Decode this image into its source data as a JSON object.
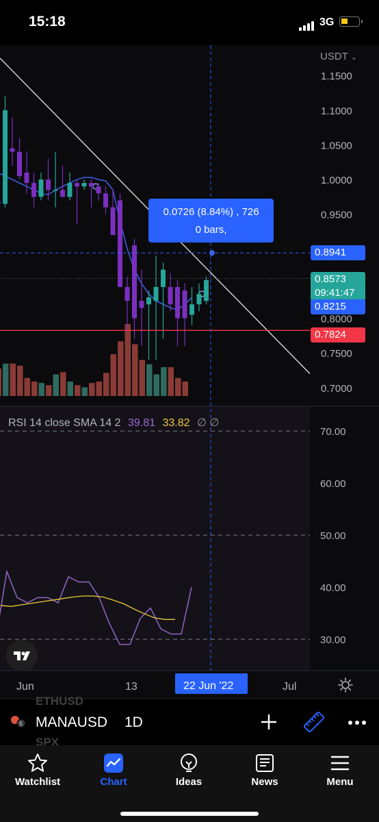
{
  "status_bar": {
    "time": "15:18",
    "network": "3G"
  },
  "chart": {
    "currency": "USDT",
    "price_axis": [
      "1.1500",
      "1.1000",
      "1.0500",
      "1.0000",
      "0.9500",
      "0.8000",
      "0.7500",
      "0.7000"
    ],
    "rsi_axis": [
      "70.00",
      "60.00",
      "50.00",
      "40.00",
      "30.00"
    ],
    "time_axis": {
      "jun": "Jun",
      "d13": "13",
      "crosshair": "22 Jun '22",
      "jul": "Jul"
    },
    "tooltip": {
      "line1": "0.0726 (8.84%) , 726",
      "line2": "0 bars,"
    },
    "price_tags": {
      "crosshair": "0.8941",
      "last": "0.8573",
      "countdown": "09:41:47",
      "sma": "0.8215",
      "horizontal": "0.7824"
    },
    "rsi_legend": {
      "name": "RSI",
      "params": "14 close SMA 14 2",
      "rsi_value": "39.81",
      "sma_value": "33.82",
      "symbols": "∅ ∅"
    },
    "colors": {
      "up": "#26a69a",
      "down": "#7b2fbf",
      "ma": "#3d62e8",
      "rsi": "#9c6ad6",
      "rsi_ma": "#f0c83c",
      "hline": "#f23645",
      "accent": "#2962ff"
    }
  },
  "chart_data": {
    "type": "candlestick",
    "symbol": "MANAUSD",
    "interval": "1D",
    "y_range": [
      0.68,
      1.17
    ],
    "candles": [
      {
        "o": 0.97,
        "h": 1.07,
        "l": 0.955,
        "c": 0.965
      },
      {
        "o": 0.965,
        "h": 1.12,
        "l": 0.96,
        "c": 1.1
      },
      {
        "o": 1.045,
        "h": 1.09,
        "l": 1.02,
        "c": 1.04
      },
      {
        "o": 1.04,
        "h": 1.06,
        "l": 1.0,
        "c": 1.005
      },
      {
        "o": 1.01,
        "h": 1.04,
        "l": 0.98,
        "c": 0.995
      },
      {
        "o": 0.995,
        "h": 1.01,
        "l": 0.96,
        "c": 0.975
      },
      {
        "o": 0.975,
        "h": 1.01,
        "l": 0.97,
        "c": 1.0
      },
      {
        "o": 1.0,
        "h": 1.03,
        "l": 0.97,
        "c": 0.985
      },
      {
        "o": 0.985,
        "h": 1.04,
        "l": 0.96,
        "c": 0.985
      },
      {
        "o": 0.985,
        "h": 1.02,
        "l": 0.975,
        "c": 0.975
      },
      {
        "o": 0.975,
        "h": 1.01,
        "l": 0.97,
        "c": 0.995
      },
      {
        "o": 0.995,
        "h": 1.0,
        "l": 0.935,
        "c": 0.99
      },
      {
        "o": 0.99,
        "h": 1.0,
        "l": 0.985,
        "c": 0.995
      },
      {
        "o": 0.995,
        "h": 1.0,
        "l": 0.96,
        "c": 0.99
      },
      {
        "o": 0.99,
        "h": 0.995,
        "l": 0.97,
        "c": 0.98
      },
      {
        "o": 0.98,
        "h": 0.99,
        "l": 0.95,
        "c": 0.96
      },
      {
        "o": 0.96,
        "h": 0.985,
        "l": 0.92,
        "c": 0.92
      },
      {
        "o": 0.97,
        "h": 0.98,
        "l": 0.85,
        "c": 0.845
      },
      {
        "o": 0.845,
        "h": 0.86,
        "l": 0.78,
        "c": 0.825
      },
      {
        "o": 0.905,
        "h": 0.915,
        "l": 0.77,
        "c": 0.8
      },
      {
        "o": 0.825,
        "h": 0.87,
        "l": 0.76,
        "c": 0.815
      },
      {
        "o": 0.82,
        "h": 0.84,
        "l": 0.74,
        "c": 0.83
      },
      {
        "o": 0.825,
        "h": 0.89,
        "l": 0.74,
        "c": 0.845
      },
      {
        "o": 0.845,
        "h": 0.88,
        "l": 0.77,
        "c": 0.87
      },
      {
        "o": 0.845,
        "h": 0.865,
        "l": 0.81,
        "c": 0.82
      },
      {
        "o": 0.845,
        "h": 0.855,
        "l": 0.76,
        "c": 0.8
      },
      {
        "o": 0.84,
        "h": 0.85,
        "l": 0.76,
        "c": 0.8
      },
      {
        "o": 0.805,
        "h": 0.845,
        "l": 0.79,
        "c": 0.82
      },
      {
        "o": 0.82,
        "h": 0.85,
        "l": 0.81,
        "c": 0.835
      },
      {
        "o": 0.825,
        "h": 0.86,
        "l": 0.82,
        "c": 0.855
      }
    ],
    "volumes": [
      0.38,
      0.45,
      0.45,
      0.42,
      0.25,
      0.2,
      0.18,
      0.15,
      0.3,
      0.33,
      0.2,
      0.15,
      0.12,
      0.18,
      0.2,
      0.32,
      0.58,
      0.76,
      1.0,
      0.72,
      0.5,
      0.44,
      0.3,
      0.4,
      0.4,
      0.25,
      0.2
    ],
    "ma": [
      1.01,
      1.005,
      1.0,
      0.995,
      0.99,
      0.985,
      0.98,
      0.978,
      0.985,
      0.99,
      0.995,
      1.0,
      1.003,
      1.003,
      1.0,
      0.998,
      0.985,
      0.94,
      0.9,
      0.87,
      0.85,
      0.835,
      0.825,
      0.82,
      0.815,
      0.812,
      0.82,
      0.83
    ],
    "rsi": [
      31,
      43,
      38,
      37,
      38,
      38,
      37,
      42,
      41,
      41,
      38,
      33,
      29,
      29,
      34,
      36,
      32,
      31,
      31,
      40
    ],
    "rsi_ma": [
      36.5,
      36.3,
      36.6,
      36.9,
      37.2,
      37.5,
      37.8,
      38.1,
      38.3,
      38.3,
      38.1,
      37.5,
      36.8,
      35.8,
      34.9,
      34.1,
      33.8,
      33.8
    ],
    "rsi_range": [
      27,
      72
    ],
    "trendline": [
      [
        1.2,
        0.56
      ],
      [
        0.72,
        0.02
      ]
    ],
    "crosshair_price": 0.8941,
    "horizontal_price": 0.7824,
    "rsi_levels": [
      70,
      50,
      30
    ]
  },
  "toolbar": {
    "symbol": "MANAUSD",
    "interval": "1D",
    "ghost_above": "ETHUSD",
    "ghost_below": "SPX"
  },
  "tabs": [
    {
      "label": "Watchlist",
      "icon": "star-icon"
    },
    {
      "label": "Chart",
      "icon": "chart-icon"
    },
    {
      "label": "Ideas",
      "icon": "lightbulb-icon"
    },
    {
      "label": "News",
      "icon": "newspaper-icon"
    },
    {
      "label": "Menu",
      "icon": "menu-icon"
    }
  ]
}
